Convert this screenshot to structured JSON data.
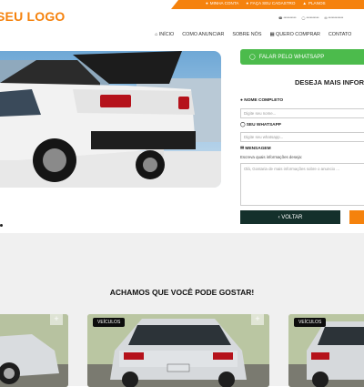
{
  "header": {
    "logo_text": "SEU LOGO",
    "top_links": [
      "MINHA CONTA",
      "FAÇA SEU CADASTRO",
      "PLANOS"
    ],
    "contacts": [
      "**********",
      "**********",
      "************"
    ]
  },
  "nav": {
    "items": [
      "INÍCIO",
      "COMO ANUNCIAR",
      "SOBRE NÓS",
      "QUERO COMPRAR",
      "CONTATO"
    ]
  },
  "form": {
    "whatsapp_button": "FALAR PELO WHATSAPP",
    "title": "DESEJA MAIS INFOR",
    "name_label": "NOME COMPLETO",
    "name_placeholder": "Digite seu nome...",
    "whatsapp_label": "SEU WHATSAPP",
    "whatsapp_placeholder": "Digite seu whatsapp...",
    "message_label": "MENSAGEM",
    "message_hint": "Escreva quais informações deseja:",
    "message_placeholder": "Olá, Gostaria de mais informações sobre o anuncio ...",
    "back_button": "VOLTAR"
  },
  "recommendations": {
    "title": "ACHAMOS QUE VOCÊ PODE GOSTAR!",
    "badge": "VEÍCULOS",
    "plus": "+"
  },
  "colors": {
    "accent": "#f5820d",
    "whatsapp": "#4cbb4c",
    "dark_button": "#14302b"
  }
}
